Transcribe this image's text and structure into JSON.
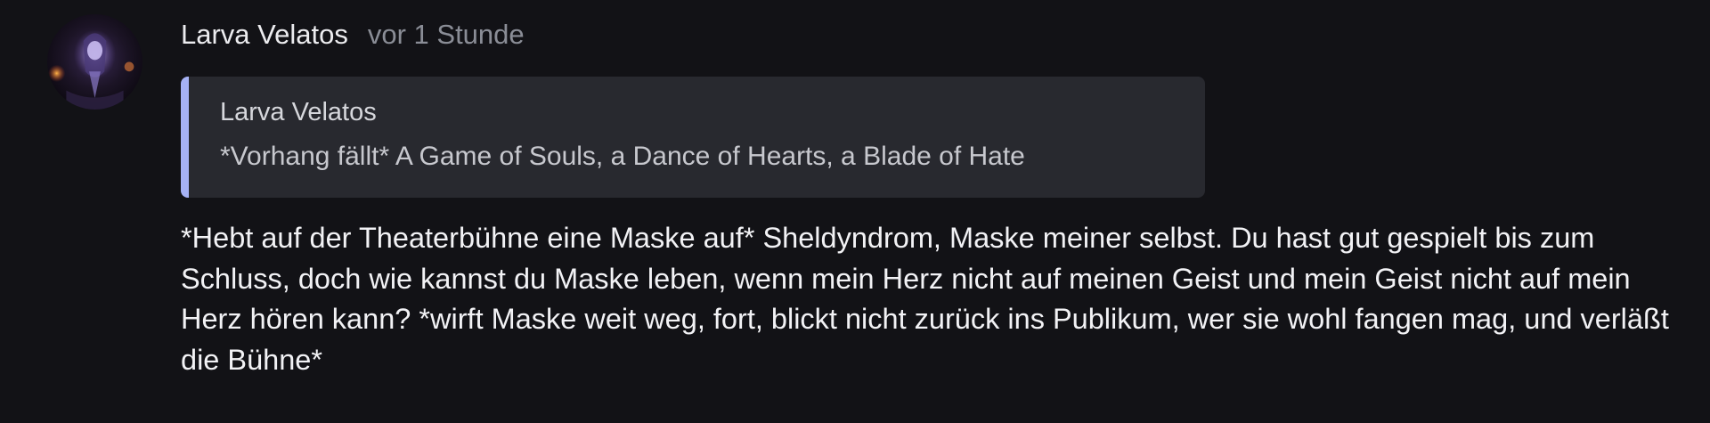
{
  "message": {
    "author": "Larva Velatos",
    "timestamp": "vor 1 Stunde",
    "avatar_icon": "avatar-image",
    "quote": {
      "author": "Larva Velatos",
      "text": "*Vorhang fällt* A Game of Souls, a Dance of Hearts, a Blade of Hate",
      "accent_color": "#a6b2f5"
    },
    "body": "*Hebt auf der Theaterbühne eine Maske auf* Sheldyndrom, Maske meiner selbst. Du hast gut gespielt bis zum Schluss, doch wie kannst du Maske leben, wenn mein Herz nicht auf meinen Geist und mein Geist nicht auf mein Herz hören kann? *wirft Maske weit weg, fort, blickt nicht zurück ins Publikum, wer sie wohl fangen mag, und verläßt die Bühne*"
  },
  "colors": {
    "background": "#121216",
    "quote_background": "#28292f",
    "text": "#f2f2f5",
    "muted": "#8a8d96"
  }
}
